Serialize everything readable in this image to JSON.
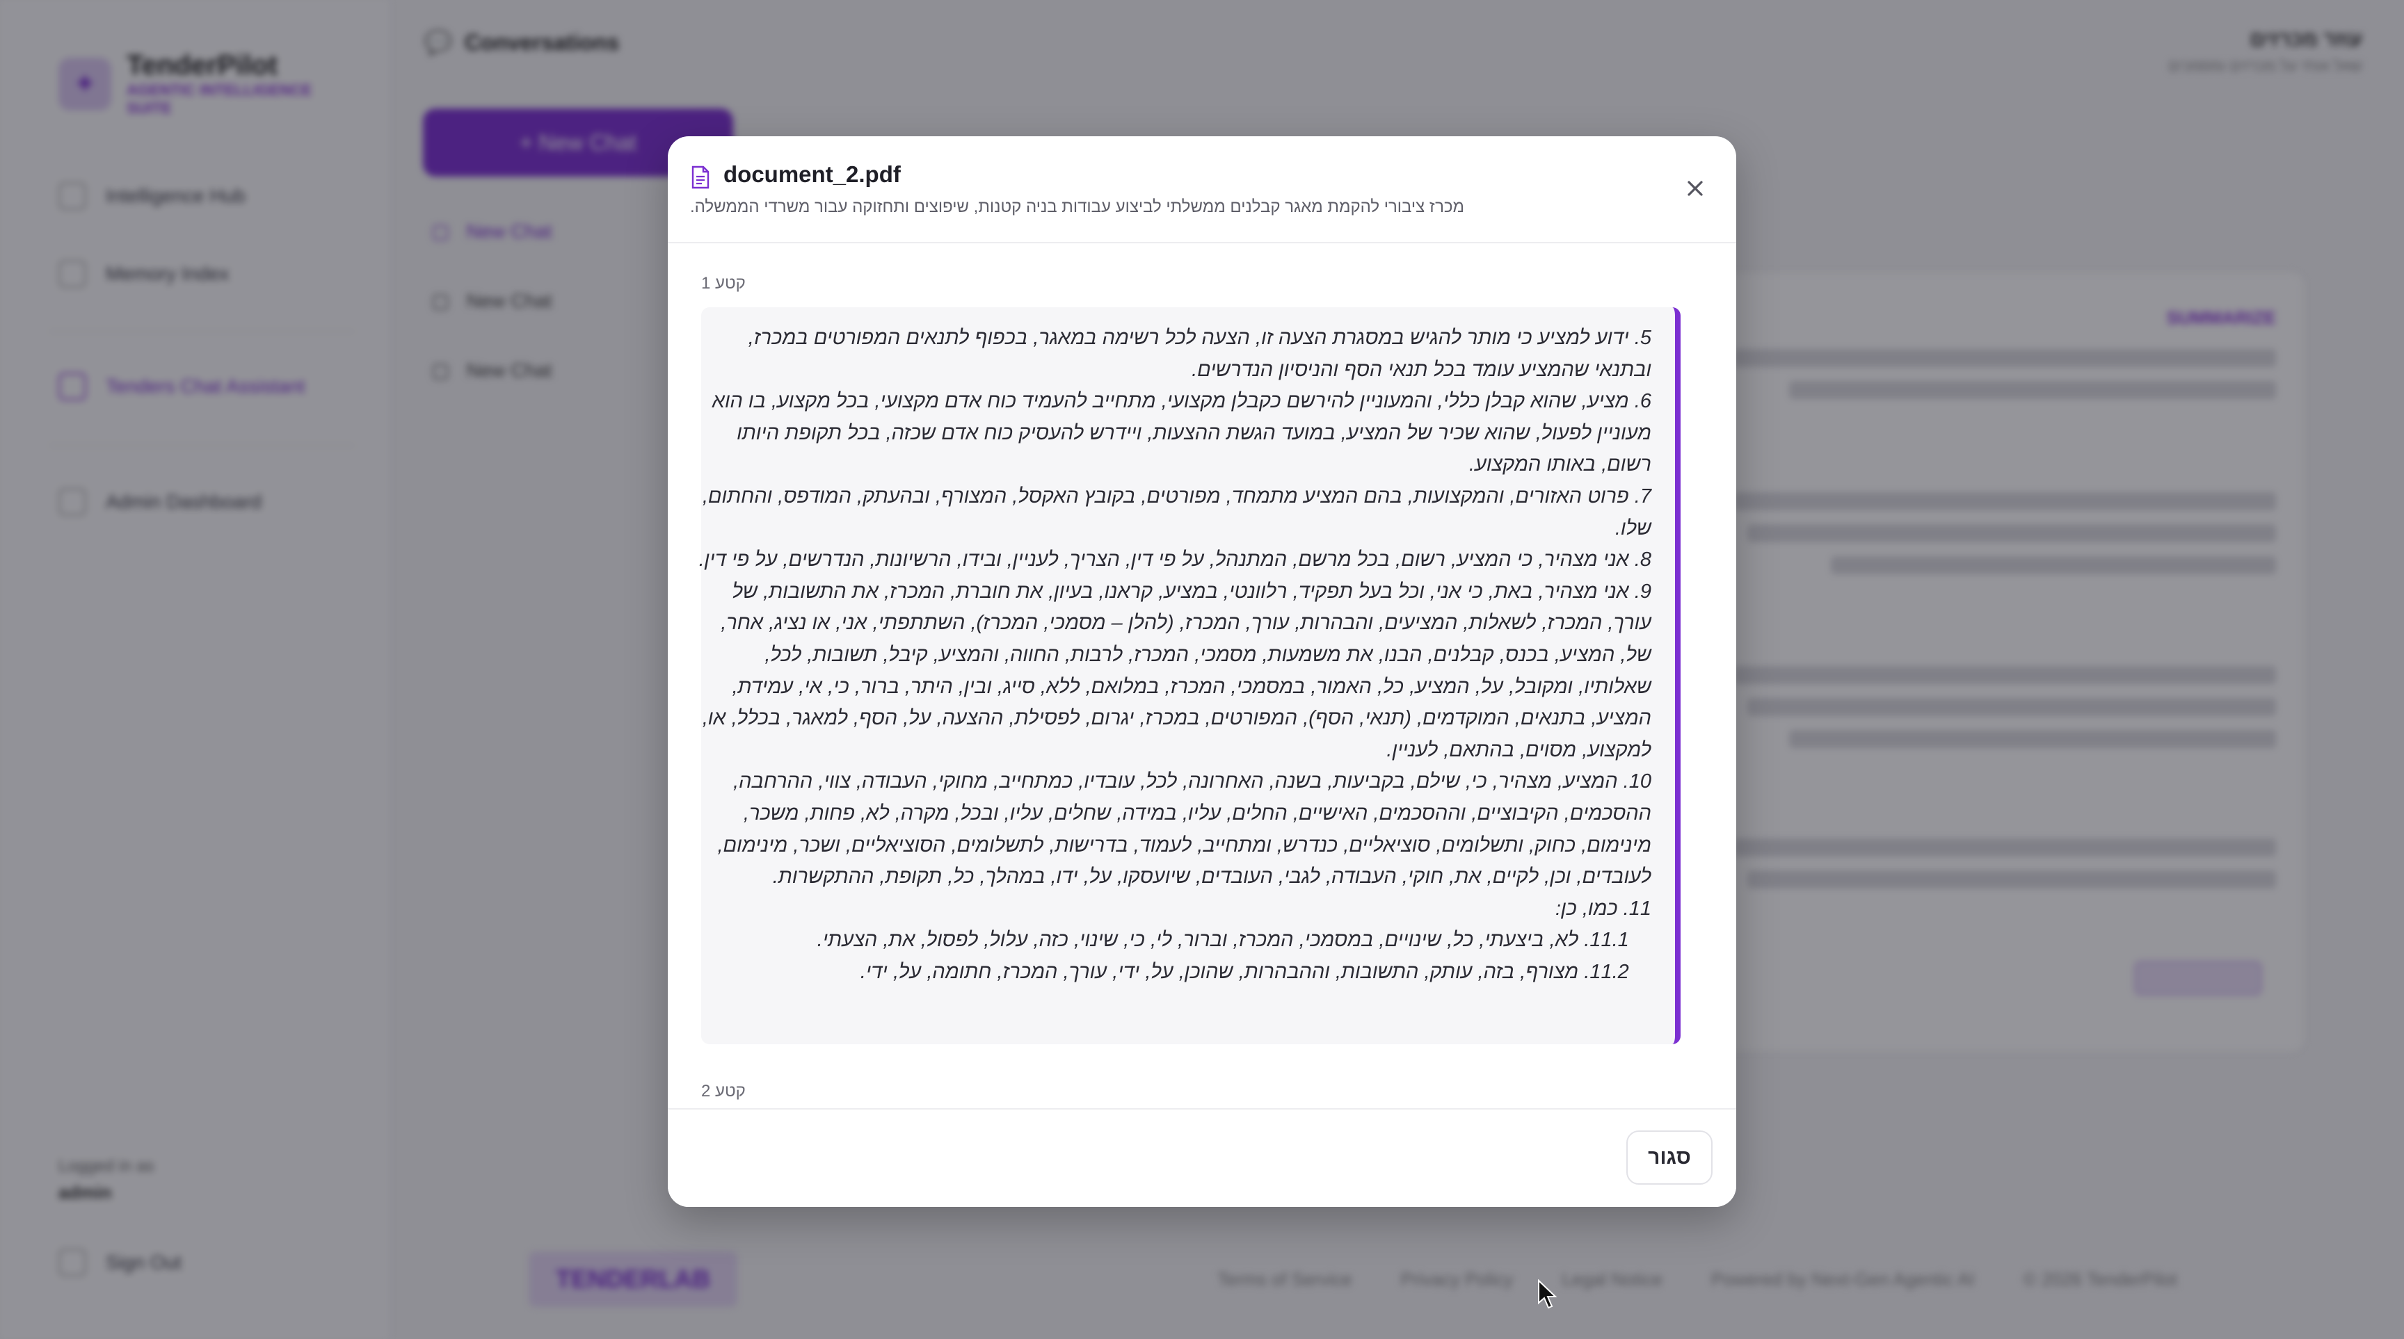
{
  "app": {
    "brand_name": "TenderPilot",
    "brand_tagline": "AGENTIC INTELLIGENCE SUITE",
    "sidebar_items": [
      {
        "label": "Intelligence Hub",
        "active": false
      },
      {
        "label": "Memory Index",
        "active": false
      },
      {
        "label": "Tenders Chat Assistant",
        "active": true
      },
      {
        "label": "Admin Dashboard",
        "active": false
      }
    ],
    "logged_in_label": "Logged in as",
    "logged_in_user": "admin",
    "sign_out": "Sign Out",
    "conversations_title": "Conversations",
    "new_chat_button": "+ New Chat",
    "conversations": [
      "New Chat",
      "New Chat",
      "New Chat"
    ],
    "top_user_name": "עוזר מכרזים",
    "top_user_sub": "שאל אותי על מכרזים ומסמכים",
    "chat_section_label": "SUMMARIZE",
    "footer_logo": "TENDERLAB",
    "footer_links": [
      "Terms of Service",
      "Privacy Policy",
      "Legal Notice",
      "Powered by Next-Gen Agentic AI",
      "© 2026 TenderPilot"
    ]
  },
  "modal": {
    "title": "document_2.pdf",
    "subtitle": "מכרז ציבורי להקמת מאגר קבלנים ממשלתי לביצוע עבודות בניה קטנות, שיפוצים ותחזוקה עבור משרדי הממשלה.",
    "segment_1_label": "קטע 1",
    "segment_1_text": "5. ידוע למציע כי מותר להגיש במסגרת הצעה זו, הצעה לכל רשימה במאגר, בכפוף לתנאים המפורטים במכרז, ובתנאי שהמציע עומד בכל תנאי הסף והניסיון הנדרשים.\n6. מציע, שהוא קבלן כללי, והמעוניין להירשם כקבלן מקצועי, מתחייב להעמיד כוח אדם מקצועי, בכל מקצוע, בו הוא מעוניין לפעול, שהוא שכיר של המציע, במועד הגשת ההצעות, ויידרש להעסיק כוח אדם שכזה, בכל תקופת היותו רשום, באותו המקצוע.\n7. פרוט האזורים, והמקצועות, בהם המציע מתמחד, מפורטים, בקובץ האקסל, המצורף, ובהעתק, המודפס, והחתום, שלו.\n8. אני מצהיר, כי המציע, רשום, בכל מרשם, המתנהל, על פי דין, הצריך, לעניין, ובידו, הרשיונות, הנדרשים, על פי דין.\n9. אני מצהיר, באת, כי אני, וכל בעל תפקיד, רלוונטי, במציע, קראנו, בעיון, את חוברת, המכרז, את התשובות, של עורך, המכרז, לשאלות, המציעים, והבהרות, עורך, המכרז, (להלן – מסמכי, המכרז), השתתפתי, אני, או נציג, אחר, של, המציע, בכנס, קבלנים, הבנו, את משמעות, מסמכי, המכרז, לרבות, החווה, והמציע, קיבל, תשובות, לכל, שאלותיו, ומקובל, על, המציע, כל, האמור, במסמכי, המכרז, במלואם, ללא, סייג, ובין, היתר, ברור, כי, אי, עמידת, המציע, בתנאים, המוקדמים, (תנאי, הסף), המפורטים, במכרז, יגרום, לפסילת, ההצעה, על, הסף, למאגר, בכלל, או, למקצוע, מסוים, בהתאם, לעניין.\n10. המציע, מצהיר, כי, שילם, בקביעות, בשנה, האחרונה, לכל, עובדיו, כמתחייב, מחוקי, העבודה, צווי, ההרחבה, ההסכמים, הקיבוציים, וההסכמים, האישיים, החלים, עליו, במידה, שחלים, עליו, ובכל, מקרה, לא, פחות, משכר, מינימום, כחוק, ותשלומים, סוציאליים, כנדרש, ומתחייב, לעמוד, בדרישות, לתשלומים, הסוציאליים, ושכר, מינימום, לעובדים, וכן, לקיים, את, חוקי, העבודה, לגבי, העובדים, שיועסקו, על, ידו, במהלך, כל, תקופת, ההתקשרות.\n11. כמו, כן:\n    11.1. לא, ביצעתי, כל, שינויים, במסמכי, המכרז, וברור, לי, כי, שינוי, כזה, עלול, לפסול, את, הצעתי.\n    11.2. מצורף, בזה, עותק, התשובות, וההבהרות, שהוכן, על, ידי, עורך, המכרז, חתומה, על, ידי.",
    "segment_2_label": "קטע 2",
    "footer_close_button": "סגור"
  }
}
